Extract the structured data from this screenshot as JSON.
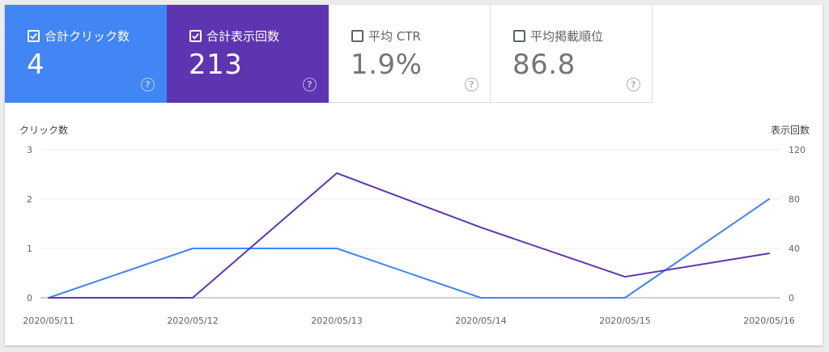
{
  "metrics": {
    "clicks": {
      "label": "合計クリック数",
      "value": "4",
      "checked": true,
      "color": "#4285f4"
    },
    "impressions": {
      "label": "合計表示回数",
      "value": "213",
      "checked": true,
      "color": "#5e35b1"
    },
    "ctr": {
      "label": "平均 CTR",
      "value": "1.9%",
      "checked": false
    },
    "position": {
      "label": "平均掲載順位",
      "value": "86.8",
      "checked": false
    }
  },
  "chart_data": {
    "type": "line",
    "x": [
      "2020/05/11",
      "2020/05/12",
      "2020/05/13",
      "2020/05/14",
      "2020/05/15",
      "2020/05/16"
    ],
    "ylabel_left": "クリック数",
    "ylabel_right": "表示回数",
    "ylim_left": [
      0,
      3
    ],
    "ylim_right": [
      0,
      120
    ],
    "yticks_left": [
      "0",
      "1",
      "2",
      "3"
    ],
    "yticks_right": [
      "0",
      "40",
      "80",
      "120"
    ],
    "grid": true,
    "series": [
      {
        "name": "合計クリック数",
        "axis": "left",
        "color": "#4285f4",
        "values": [
          0,
          1,
          1,
          0,
          0,
          2
        ]
      },
      {
        "name": "合計表示回数",
        "axis": "right",
        "color": "#5e35b1",
        "values": [
          0,
          0,
          101,
          57,
          17,
          36
        ]
      }
    ]
  }
}
